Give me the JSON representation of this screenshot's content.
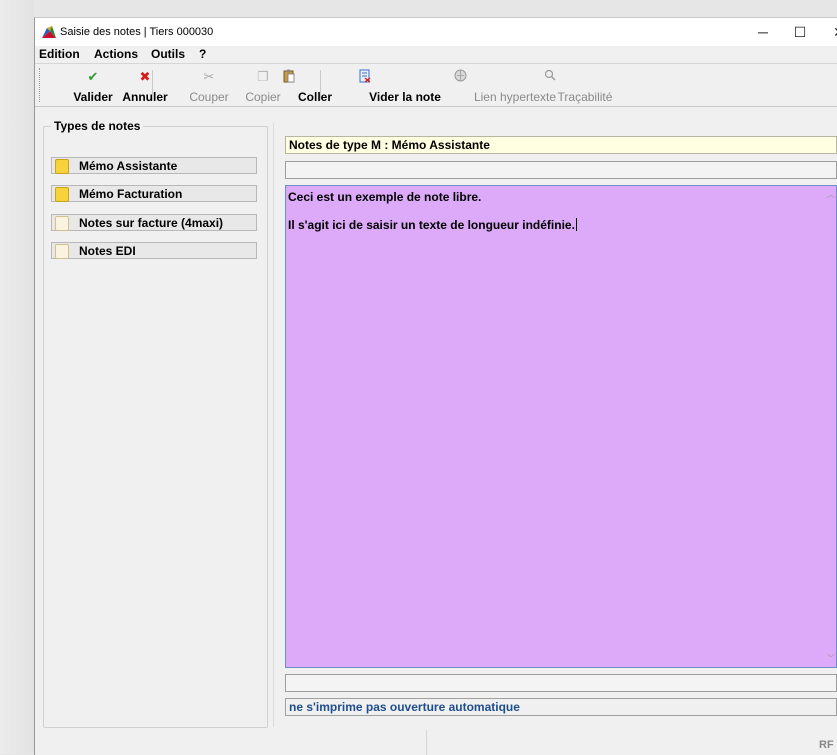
{
  "window": {
    "title": "Saisie des notes | Tiers 000030",
    "controls": {
      "minimize": "─",
      "maximize": "☐",
      "close": "✕"
    }
  },
  "menu": [
    "Edition",
    "Actions",
    "Outils",
    "?"
  ],
  "toolbar": {
    "valider": {
      "label": "Valider",
      "icon": "check-icon",
      "glyph": "✔",
      "color": "#2e9e2e"
    },
    "annuler": {
      "label": "Annuler",
      "icon": "cross-icon",
      "glyph": "✖",
      "color": "#d81b1b"
    },
    "couper": {
      "label": "Couper",
      "icon": "scissors-icon",
      "glyph": "✂",
      "color": "#9a9a9a"
    },
    "copier": {
      "label": "Copier",
      "icon": "copy-icon",
      "glyph": "❐",
      "color": "#b0b0b0"
    },
    "coller": {
      "label": "Coller",
      "icon": "paste-icon",
      "glyph": "📋",
      "color": "#8a6a2a"
    },
    "vider": {
      "label": "Vider la note",
      "icon": "clear-note-icon",
      "glyph": "🗎",
      "color": "#3b6fc2"
    },
    "lien": {
      "label": "Lien hypertexte",
      "icon": "hyperlink-icon",
      "glyph": "🔗",
      "color": "#9a9a9a"
    },
    "tracabilite": {
      "label": "Traçabilité",
      "icon": "magnifier-icon",
      "glyph": "🔍",
      "color": "#9a9a9a"
    }
  },
  "types_panel": {
    "title": "Types de notes",
    "items": [
      {
        "label": "Mémo Assistante",
        "icon": "note-icon",
        "color": "#f7d23a"
      },
      {
        "label": "Mémo Facturation",
        "icon": "note-icon",
        "color": "#f7d23a"
      },
      {
        "label": "Notes sur facture (4maxi)",
        "icon": "note-icon",
        "color": "#faf3e0"
      },
      {
        "label": "Notes EDI",
        "icon": "note-icon",
        "color": "#faf3e0"
      }
    ]
  },
  "note": {
    "header": "Notes de type M : Mémo Assistante",
    "subfield": "",
    "lines": [
      "Ceci est un exemple de note libre.",
      "Il s'agit ici de saisir un texte de longueur indéfinie."
    ],
    "background": "#dcaaf9",
    "footer_field": "",
    "status": "ne s'imprime pas ouverture automatique"
  },
  "statusbar": {
    "right_text": "RF"
  }
}
